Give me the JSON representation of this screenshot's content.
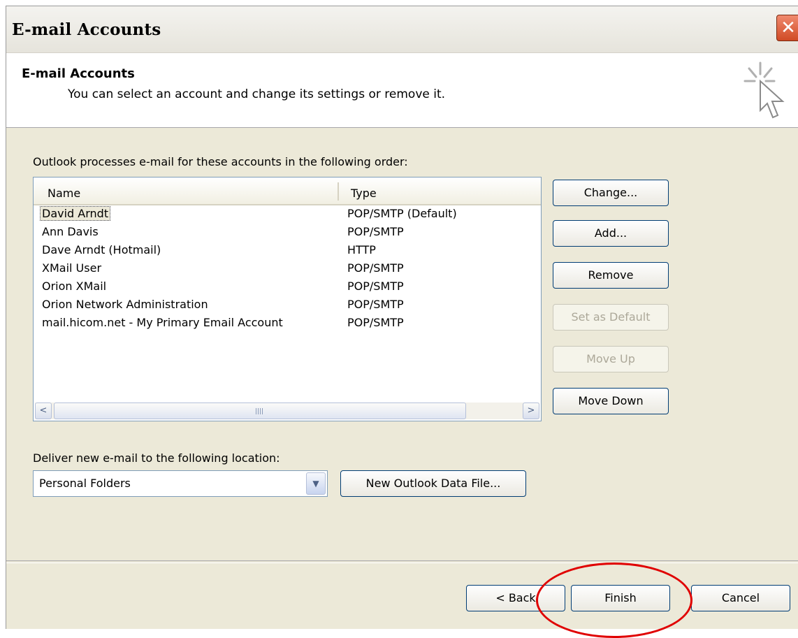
{
  "window": {
    "title": "E-mail Accounts",
    "close_glyph": "✕"
  },
  "header": {
    "title": "E-mail Accounts",
    "subtitle": "You can select an account and change its settings or remove it.",
    "icon": "wizard-cursor-icon"
  },
  "accounts": {
    "label": "Outlook processes e-mail for these accounts in the following order:",
    "columns": {
      "name": "Name",
      "type": "Type"
    },
    "rows": [
      {
        "name": "David Arndt",
        "type": "POP/SMTP (Default)",
        "selected": true
      },
      {
        "name": "Ann Davis",
        "type": "POP/SMTP"
      },
      {
        "name": "Dave Arndt (Hotmail)",
        "type": "HTTP"
      },
      {
        "name": "XMail User",
        "type": "POP/SMTP"
      },
      {
        "name": "Orion XMail",
        "type": "POP/SMTP"
      },
      {
        "name": "Orion Network Administration",
        "type": "POP/SMTP"
      },
      {
        "name": "mail.hicom.net - My Primary Email Account",
        "type": "POP/SMTP"
      }
    ],
    "scroll_left": "<",
    "scroll_right": ">"
  },
  "side_buttons": {
    "change": "Change...",
    "add": "Add...",
    "remove": "Remove",
    "set_default": "Set as Default",
    "move_up": "Move Up",
    "move_down": "Move Down"
  },
  "delivery": {
    "label": "Deliver new e-mail to the following location:",
    "selected": "Personal Folders",
    "new_file_button": "New Outlook Data File..."
  },
  "footer": {
    "back": "< Back",
    "finish": "Finish",
    "cancel": "Cancel"
  },
  "annotation": {
    "color": "#e00000",
    "target": "finish-button"
  }
}
